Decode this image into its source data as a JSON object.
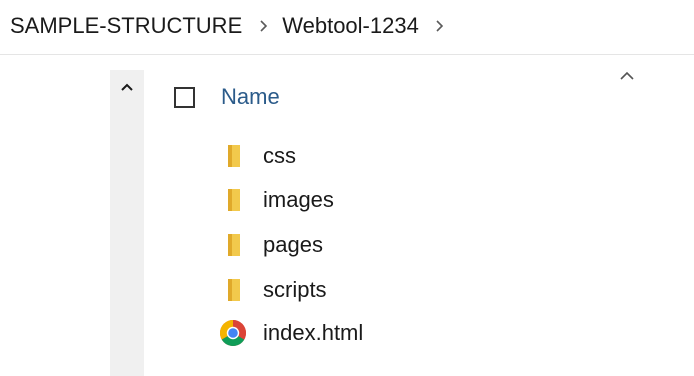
{
  "breadcrumb": {
    "items": [
      {
        "label": "SAMPLE-STRUCTURE"
      },
      {
        "label": "Webtool-1234"
      }
    ]
  },
  "list": {
    "header": {
      "name_label": "Name"
    },
    "items": [
      {
        "name": "css",
        "icon": "folder-icon"
      },
      {
        "name": "images",
        "icon": "folder-icon"
      },
      {
        "name": "pages",
        "icon": "folder-icon"
      },
      {
        "name": "scripts",
        "icon": "folder-icon"
      },
      {
        "name": "index.html",
        "icon": "chrome-icon"
      }
    ]
  },
  "colors": {
    "folder": "#f2c94c",
    "header_text": "#2b5b8a",
    "strip": "#f0f0f0"
  }
}
